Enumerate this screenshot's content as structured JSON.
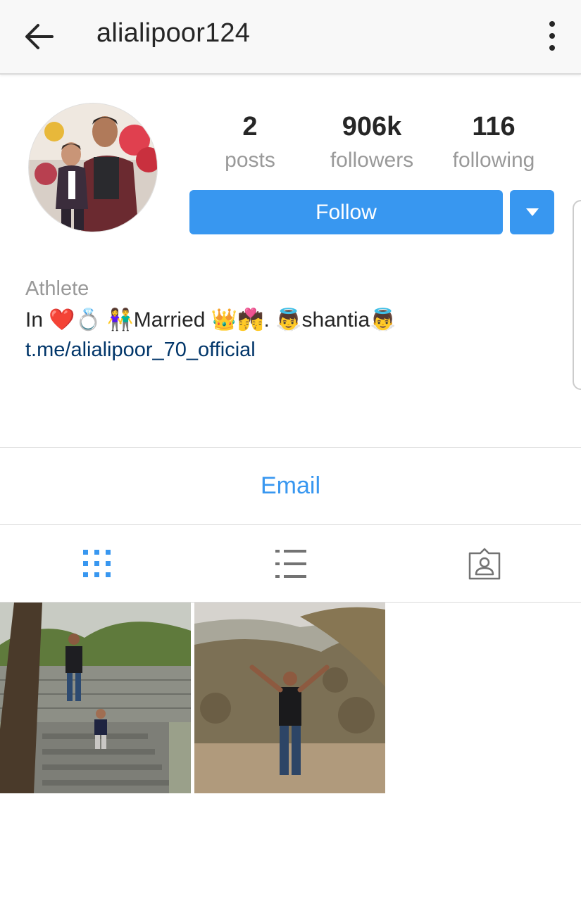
{
  "header": {
    "username": "alialipoor124",
    "back_icon": "arrow-left-icon",
    "menu_icon": "more-vertical-icon"
  },
  "stats": {
    "posts": {
      "value": "2",
      "label": "posts"
    },
    "followers": {
      "value": "906k",
      "label": "followers"
    },
    "following": {
      "value": "116",
      "label": "following"
    }
  },
  "actions": {
    "follow_label": "Follow",
    "dropdown_icon": "caret-down-icon"
  },
  "bio": {
    "category": "Athlete",
    "line": "In ❤️💍 👫Married 👑💏. 👼shantia👼",
    "link": "t.me/alialipoor_70_official"
  },
  "contact": {
    "email_label": "Email"
  },
  "tabs": [
    {
      "icon": "grid-icon",
      "active": true
    },
    {
      "icon": "list-icon",
      "active": false
    },
    {
      "icon": "tagged-icon",
      "active": false
    }
  ],
  "colors": {
    "accent": "#3897f0",
    "link": "#003569",
    "muted": "#999999",
    "text": "#262626"
  }
}
